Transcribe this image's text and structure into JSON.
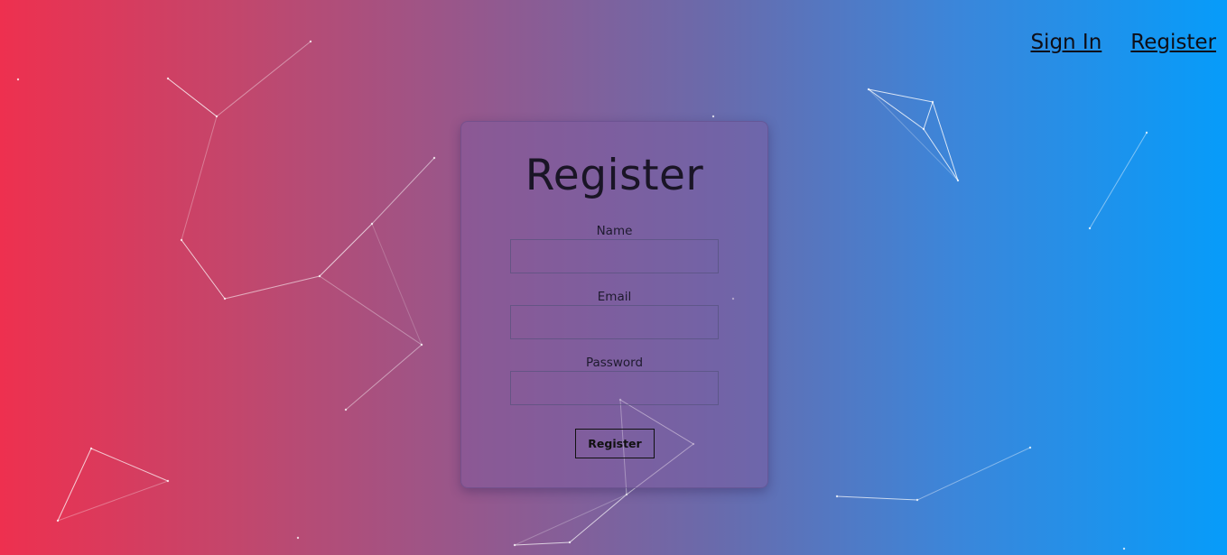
{
  "nav": {
    "sign_in": "Sign In",
    "register": "Register"
  },
  "form": {
    "title": "Register",
    "name_label": "Name",
    "name_value": "",
    "email_label": "Email",
    "email_value": "",
    "password_label": "Password",
    "password_value": "",
    "submit_label": "Register"
  },
  "colors": {
    "gradient_left": "#ee304f",
    "gradient_right": "#069cfa",
    "particle_line": "#ffffff"
  }
}
